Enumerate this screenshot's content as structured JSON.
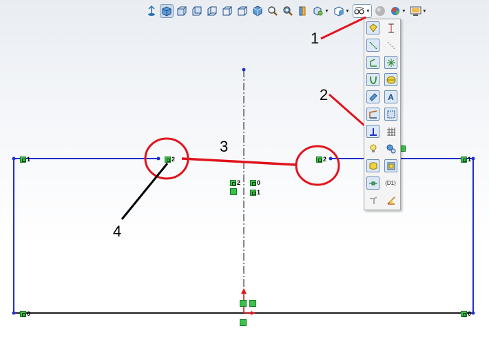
{
  "toolbar": {
    "icons": [
      "view-orientation-icon",
      "display-style-icon",
      "front-view-icon",
      "back-view-icon",
      "left-view-icon",
      "right-view-icon",
      "top-view-icon",
      "isometric-view-icon",
      "zoom-fit-icon",
      "zoom-area-icon",
      "section-view-icon",
      "hide-show-icon",
      "appearance-icon",
      "relations-dropdown-icon",
      "record-icon",
      "scene-icon",
      "display-pane-icon"
    ]
  },
  "popup": {
    "text_icon_label": "(D1)"
  },
  "relations": [
    {
      "id": "top-left-corner",
      "num": "1"
    },
    {
      "id": "top-left-mid",
      "num": "2"
    },
    {
      "id": "center-a",
      "num": "2"
    },
    {
      "id": "center-b",
      "num": "0"
    },
    {
      "id": "center-c",
      "num": "1"
    },
    {
      "id": "top-right-mid",
      "num": "2"
    },
    {
      "id": "top-right-corner",
      "num": "1"
    },
    {
      "id": "bottom-left-corner",
      "num": "0"
    },
    {
      "id": "bottom-right-corner",
      "num": "0"
    }
  ],
  "annotations": {
    "a1": "1",
    "a2": "2",
    "a3": "3",
    "a4": "4"
  },
  "colors": {
    "sketch": "#1f2fd0",
    "annotation": "#e0141c",
    "relation": "#3cc24a"
  }
}
